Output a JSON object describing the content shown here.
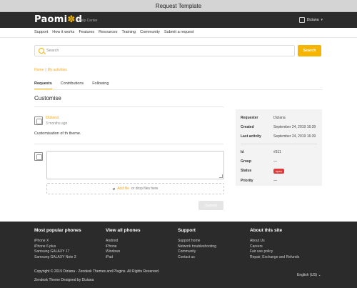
{
  "window": {
    "title": "Request Template"
  },
  "header": {
    "logo": "Paomi",
    "logo_icon": "✽",
    "logo_suffix": "d",
    "help_center": "Help Center",
    "user_name": "Diziana",
    "caret": "▾"
  },
  "nav": {
    "items": [
      "Support",
      "How it works",
      "Features",
      "Resources",
      "Training",
      "Community",
      "Submit a request"
    ]
  },
  "search": {
    "placeholder": "Search",
    "button": "Search",
    "accent": "#f5b400"
  },
  "breadcrumbs": {
    "home": "Home",
    "sep": "|",
    "current": "My activities"
  },
  "tabs": [
    "Requests",
    "Contributions",
    "Following"
  ],
  "request": {
    "title": "Customise",
    "comment": {
      "author": "Diziana",
      "time": "3 months ago",
      "body": "Customisation of th theme."
    },
    "reply": {
      "add_file": "Add file",
      "drop_hint": "or drop files here",
      "submit": "Submit"
    }
  },
  "details": {
    "requester_label": "Requester",
    "requester": "Diziana",
    "created_label": "Created",
    "created": "September 24, 2019 16:39",
    "last_activity_label": "Last activity",
    "last_activity": "September 24, 2019 16:39",
    "id_label": "Id",
    "id": "#311",
    "group_label": "Group",
    "group": "—",
    "status_label": "Status",
    "status": "open",
    "priority_label": "Priority",
    "priority": "—",
    "status_color": "#e03a3a"
  },
  "footer": {
    "col1": {
      "title": "Most popular phones",
      "items": [
        "iPhone X",
        "iPhone 6 plus",
        "Samsung GALAXY J7",
        "Samsung GALAXY Note 3"
      ]
    },
    "col2": {
      "title": "View all phones",
      "items": [
        "Android",
        "iPhone",
        "Windows",
        "iPad"
      ]
    },
    "col3": {
      "title": "Support",
      "items": [
        "Support home",
        "Network troubleshooting",
        "Community",
        "Contact us"
      ]
    },
    "col4": {
      "title": "About this site",
      "items": [
        "About Us",
        "Careers",
        "Fair use policy",
        "Repair, Exchange and Refunds"
      ]
    },
    "copyright": "Copyright © 2019 Diziana - Zendesk Themes and Plugins. All Rights Reserved.",
    "designed_by": "Zendesk Theme Designed by Diziana",
    "language": "English (US) ⌄"
  }
}
